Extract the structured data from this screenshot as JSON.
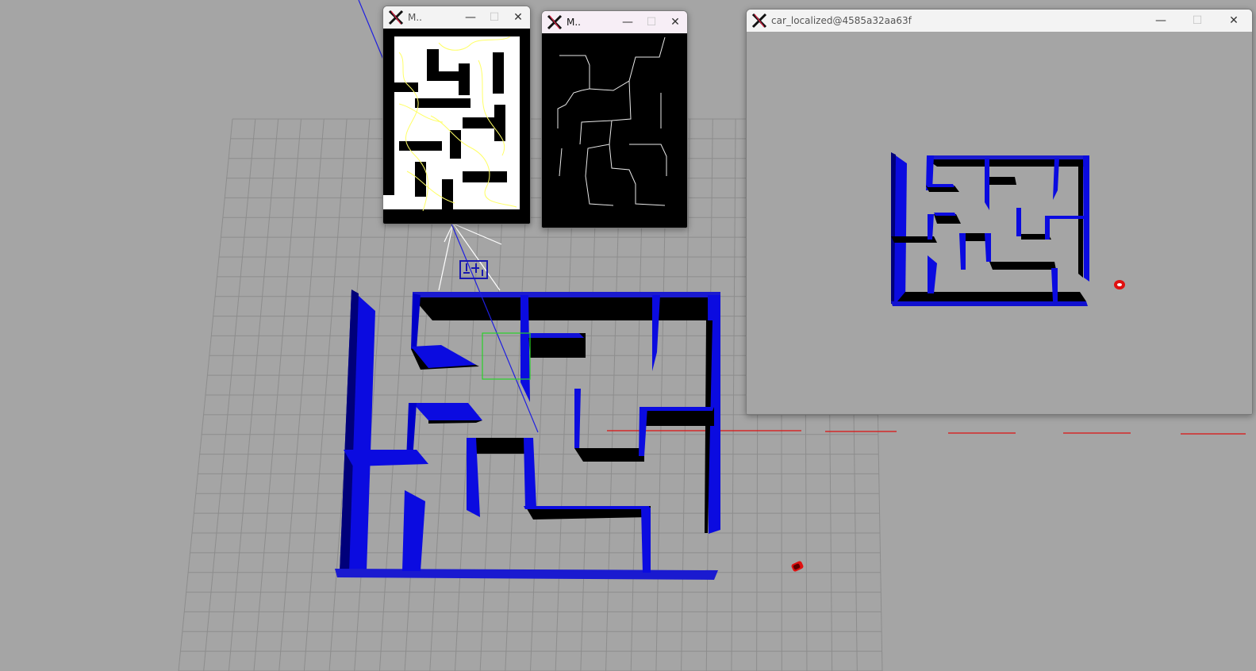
{
  "viewport": {
    "background": "#a5a5a5",
    "grid_color": "#8e8e8e",
    "wall_color": "#0a0ad2",
    "robot_color": "#e01010",
    "axis_color": "#dd1111"
  },
  "windows": {
    "path_window": {
      "title": "M..",
      "path_color": "#ffff66"
    },
    "graph_window": {
      "title": "M.."
    },
    "localized_window": {
      "title": "car_localized@4585a32aa63f"
    }
  },
  "controls": {
    "minimize_glyph": "—",
    "maximize_glyph": "☐",
    "close_glyph": "✕"
  },
  "icons": [
    "x11-logo-icon",
    "minimize-icon",
    "maximize-icon",
    "close-icon"
  ]
}
